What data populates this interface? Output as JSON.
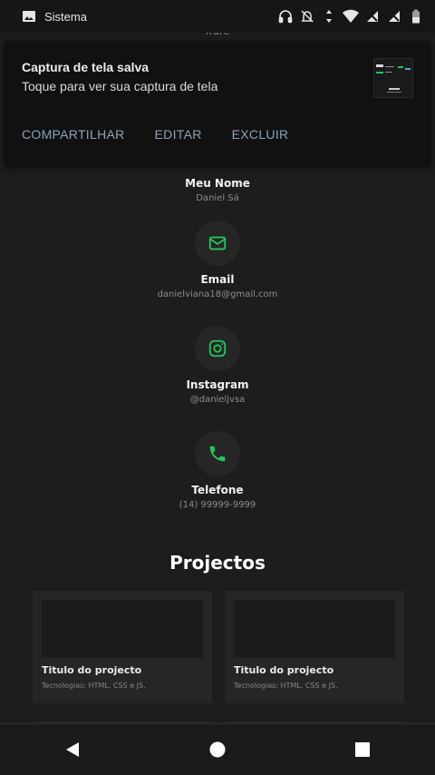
{
  "status_bar": {
    "app_name": "Sistema",
    "icons": [
      "image-icon",
      "headphones-icon",
      "bell-off-icon",
      "data-arrows-icon",
      "wifi-icon",
      "signal-off-icon",
      "signal-off-icon",
      "battery-icon"
    ]
  },
  "page": {
    "peek_text": "frure",
    "contacts": [
      {
        "icon": "user-icon",
        "title": "Meu Nome",
        "value": "Daniel Sá"
      },
      {
        "icon": "email-icon",
        "title": "Email",
        "value": "danielviana18@gmail.com"
      },
      {
        "icon": "instagram-icon",
        "title": "Instagram",
        "value": "@danieljvsa"
      },
      {
        "icon": "phone-icon",
        "title": "Telefone",
        "value": "(14) 99999-9999"
      }
    ],
    "projects_title": "Projectos",
    "projects": [
      {
        "title": "Titulo do projecto",
        "tech": "Tecnologias: HTML, CSS e JS."
      },
      {
        "title": "Titulo do projecto",
        "tech": "Tecnologias: HTML, CSS e JS."
      }
    ],
    "accent_color": "#22c55e"
  },
  "notification": {
    "title": "Captura de tela salva",
    "text": "Toque para ver sua captura de tela",
    "actions": [
      "COMPARTILHAR",
      "EDITAR",
      "EXCLUIR"
    ]
  },
  "nav_bar": {
    "buttons": [
      "back-icon",
      "home-icon",
      "recents-icon"
    ]
  }
}
